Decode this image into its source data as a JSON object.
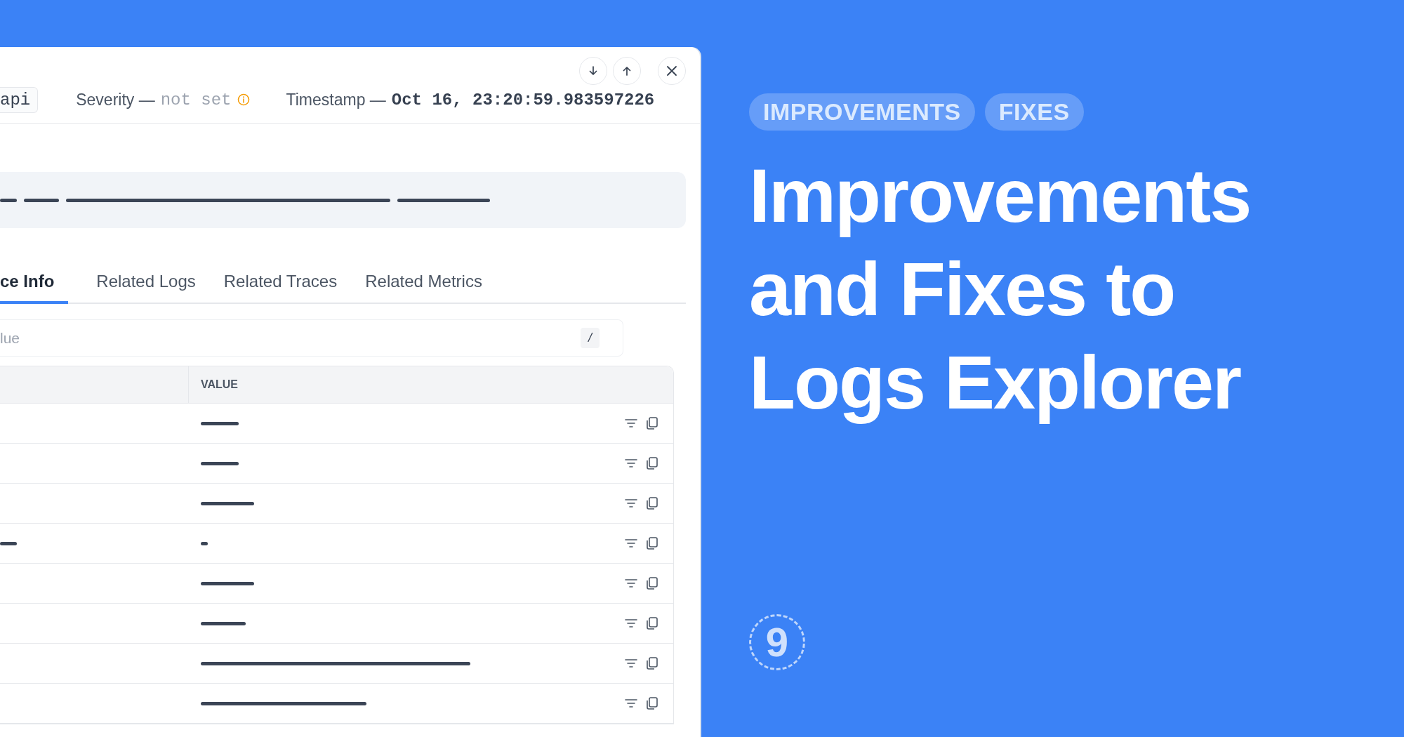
{
  "log_panel": {
    "meta": {
      "source": "api",
      "severity_label": "Severity —",
      "severity_value": "not set",
      "timestamp_label": "Timestamp —",
      "timestamp_value": "Oct 16, 23:20:59.983597226"
    },
    "tabs": [
      {
        "label": "ce Info",
        "selected": true
      },
      {
        "label": "Related Logs",
        "selected": false
      },
      {
        "label": "Related Traces",
        "selected": false
      },
      {
        "label": "Related Metrics",
        "selected": false
      }
    ],
    "search": {
      "placeholder": "lue",
      "shortcut": "/"
    },
    "table": {
      "columns": [
        "VALUE"
      ]
    }
  },
  "announcement": {
    "tags": [
      "IMPROVEMENTS",
      "FIXES"
    ],
    "title_lines": [
      "Improvements",
      "and Fixes to",
      "Logs Explorer"
    ],
    "logo": "9"
  }
}
